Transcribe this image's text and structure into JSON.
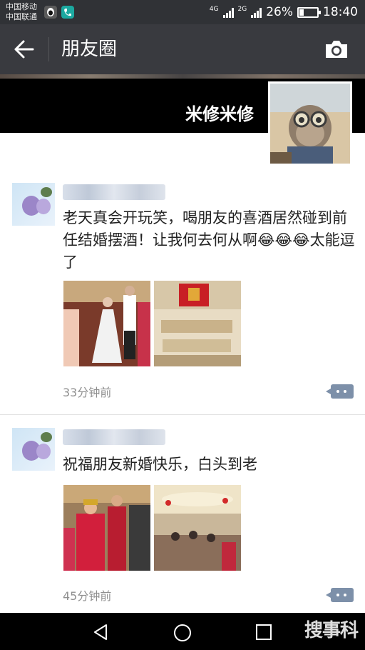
{
  "status_bar": {
    "carrier_1": "中国移动",
    "carrier_2": "中国联通",
    "network_1": "4G",
    "network_2": "2G",
    "battery_percent": "26%",
    "battery_level": 0.26,
    "time": "18:40"
  },
  "header": {
    "title": "朋友圈"
  },
  "profile": {
    "name": "米修米修"
  },
  "posts": [
    {
      "text": "老天真会开玩笑，喝朋友的喜酒居然碰到前任结婚摆酒！让我何去何从啊😂😂😂太能逗了",
      "time": "33分钟前"
    },
    {
      "text": "祝福朋友新婚快乐，白头到老",
      "time": "45分钟前"
    }
  ],
  "watermark": "搜事科",
  "colors": {
    "topbar": "#393a3f",
    "statusbar": "#303236",
    "comment_button": "#7d90a9"
  }
}
